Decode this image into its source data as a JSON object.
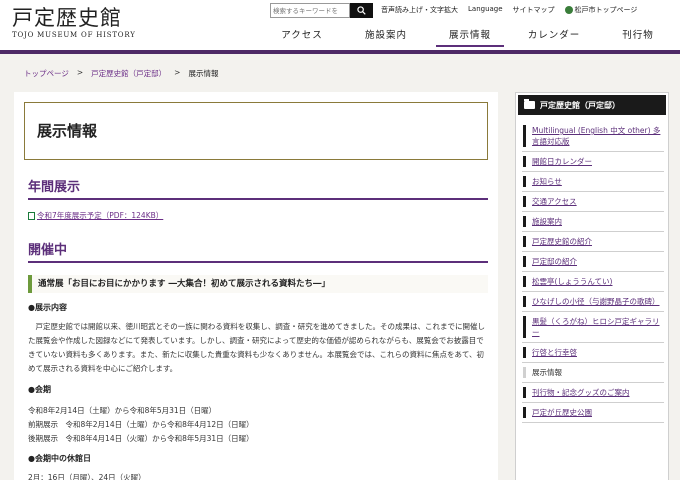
{
  "header": {
    "logo_jp": "戸定歴史館",
    "logo_en": "TOJO MUSEUM OF HISTORY",
    "search_placeholder": "検索するキーワードを",
    "utils": [
      "音声読み上げ・文字拡大",
      "Language",
      "サイトマップ"
    ],
    "city_link": "松戸市トップページ"
  },
  "gnav": [
    "アクセス",
    "施設案内",
    "展示情報",
    "カレンダー",
    "刊行物"
  ],
  "gnav_active_index": 2,
  "breadcrumb": {
    "home": "トップページ",
    "parent": "戸定歴史館（戸定邸）",
    "current": "展示情報",
    "sep": ">"
  },
  "main": {
    "title": "展示情報",
    "annual_heading": "年間展示",
    "pdf_link": "令和7年度展示予定（PDF：124KB）",
    "now_heading": "開催中",
    "exhibit_title": "通常展「お目にお目にかかります ―大集合！初めて展示される資料たち―」",
    "content_heading": "●展示内容",
    "content_text": "　戸定歴史館では開館以来、徳川昭武とその一族に関わる資料を収集し、調査・研究を進めてきました。その成果は、これまでに開催した展覧会や作成した図録などにて発表しています。しかし、調査・研究によって歴史的な価値が認められながらも、展覧会でお披露目できていない資料も多くあります。また、新たに収集した貴重な資料も少なくありません。本展覧会では、これらの資料に焦点をあて、初めて展示される資料を中心にご紹介します。",
    "period_heading": "●会期",
    "period_lines": [
      "令和8年2月14日（土曜）から令和8年5月31日（日曜）",
      "前期展示　令和8年2月14日（土曜）から令和8年4月12日（日曜）",
      "後期展示　令和8年4月14日（火曜）から令和8年5月31日（日曜）"
    ],
    "closed_heading": "●会期中の休館日",
    "closed_text": "2月：16日（月曜）、24日（火曜）"
  },
  "sidebar": {
    "heading": "戸定歴史館（戸定邸）",
    "items": [
      "Multilingual (English 中文 other) 多言語対応版",
      "開館日カレンダー",
      "お知らせ",
      "交通アクセス",
      "施設案内",
      "戸定歴史館の紹介",
      "戸定邸の紹介",
      "松雲亭(しょううんてい)",
      "ひなげしの小径（与謝野晶子の歌碑）",
      "黒髪（くろがね）ヒロシ戸定ギャラリー",
      "行啓と行幸啓",
      "展示情報",
      "刊行物・記念グッズのご案内",
      "戸定が丘歴史公園"
    ],
    "current_index": 11
  },
  "colors": {
    "accent_purple": "#5c2f7a",
    "link_purple": "#6a2c86",
    "header_bar": "#4e2a66",
    "exhibit_marker_green": "#6d9a3c"
  },
  "icons": [
    "search-icon",
    "pdf-icon",
    "city-emblem-icon",
    "folder-icon"
  ]
}
